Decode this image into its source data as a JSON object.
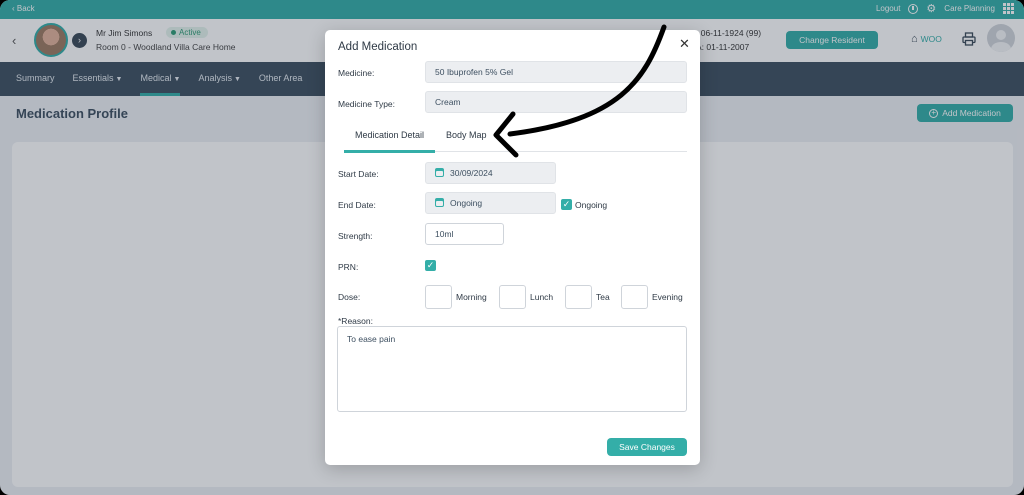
{
  "topbar": {
    "back_label": "‹ Back",
    "logout_label": "Logout",
    "app_label": "Care Planning"
  },
  "resident": {
    "name": "Mr Jim Simons",
    "status": "Active",
    "room": "Room 0 - Woodland Villa Care Home",
    "dob_fragment": ": 06-11-1924 (99)",
    "admission_fragment": "A: 01-11-2007",
    "change_button": "Change Resident",
    "home_code": "WOO"
  },
  "nav": {
    "items": [
      "Summary",
      "Essentials",
      "Medical",
      "Analysis",
      "Other Area"
    ],
    "active": "Medical"
  },
  "page": {
    "title": "Medication Profile",
    "add_button": "Add Medication"
  },
  "modal": {
    "title": "Add Medication",
    "medicine_label": "Medicine:",
    "medicine_value": "50 Ibuprofen 5% Gel",
    "type_label": "Medicine Type:",
    "type_value": "Cream",
    "tabs": [
      "Medication Detail",
      "Body Map"
    ],
    "start_label": "Start Date:",
    "start_value": "30/09/2024",
    "end_label": "End Date:",
    "end_value": "Ongoing",
    "ongoing_label": "Ongoing",
    "strength_label": "Strength:",
    "strength_value": "10ml",
    "prn_label": "PRN:",
    "dose_label": "Dose:",
    "dose_times": [
      "Morning",
      "Lunch",
      "Tea",
      "Evening"
    ],
    "reason_label": "*Reason:",
    "reason_value": "To ease pain",
    "save_button": "Save Changes"
  },
  "colors": {
    "accent": "#34aea8",
    "nav_bg": "#3d4f60"
  }
}
